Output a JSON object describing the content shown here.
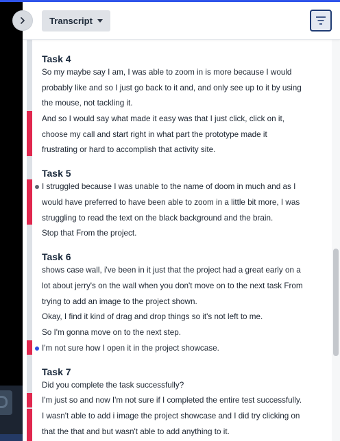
{
  "header": {
    "dropdown_label": "Transcript",
    "icons": {
      "collapse": "chevron-right-icon",
      "dropdown": "caret-down-icon",
      "filter": "filter-lines-icon"
    }
  },
  "colors": {
    "highlight": "#e0274e",
    "accent": "#2f54eb",
    "timeline": "#dde1e6",
    "dot_grey": "#5e6570",
    "dot_blue": "#2d4fe0"
  },
  "tasks": [
    {
      "title": "Task 4",
      "lines": [
        "So my maybe say I am, I was able to zoom in is more because I would",
        "probably like and so I just go back to it and, and only see up to it by using",
        "the mouse, not tackling it.",
        "And so I would say what made it easy was that I just click, click on it,",
        "choose my call and start right in what part the prototype made it",
        "frustrating or hard to accomplish that activity site."
      ]
    },
    {
      "title": "Task 5",
      "lines": [
        "I struggled because I was unable to the name of doom in much and as I",
        "would have preferred to have been able to zoom in a little bit more, I was",
        "struggling to read the text on the black background and the brain.",
        "Stop that From the project."
      ]
    },
    {
      "title": "Task 6",
      "lines": [
        "shows case wall, i've been in it just that the project had a great early on a",
        "lot about jerry's on the wall when you don't move on to the next task From",
        "trying to add an image to the project shown.",
        "Okay, I find it kind of drag and drop things so it's not left to me.",
        "So I'm gonna move on to the next step.",
        "I'm not sure how I open it in the project showcase."
      ]
    },
    {
      "title": "Task 7",
      "lines": [
        "Did you complete the task successfully?",
        "I'm just so and now I'm not sure if I completed the entire test successfully.",
        "I wasn't able to add i image the project showcase and I did try clicking on",
        "that the that and but wasn't able to add anything to it."
      ]
    }
  ]
}
